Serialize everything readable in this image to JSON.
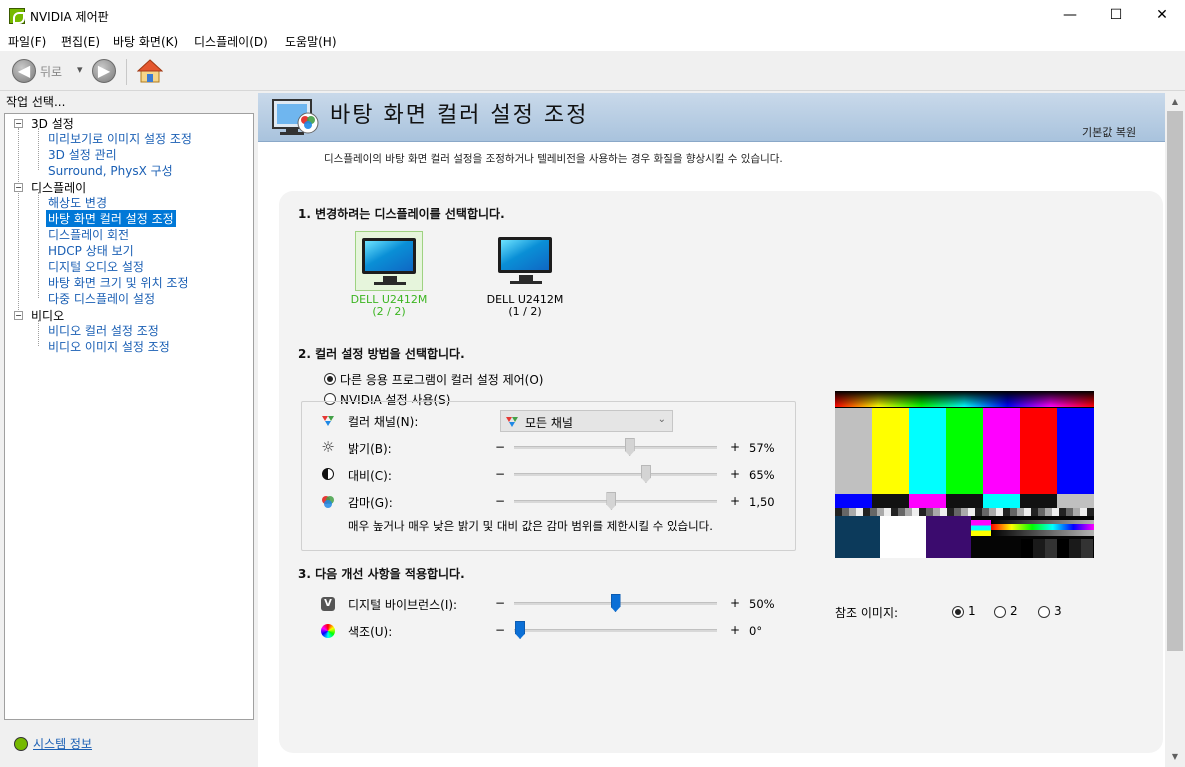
{
  "window": {
    "title": "NVIDIA 제어판",
    "minimize": "—",
    "maximize": "☐",
    "close": "✕"
  },
  "menu": [
    "파일(F)",
    "편집(E)",
    "바탕 화면(K)",
    "디스플레이(D)",
    "도움말(H)"
  ],
  "toolbar": {
    "back_label": "뒤로",
    "back_arrow": "◀",
    "forward_arrow": "▶",
    "dropdown": "▾"
  },
  "left": {
    "header": "작업 선택...",
    "tree": [
      {
        "label": "3D 설정",
        "children": [
          "미리보기로 이미지 설정 조정",
          "3D 설정 관리",
          "Surround, PhysX 구성"
        ]
      },
      {
        "label": "디스플레이",
        "children": [
          "해상도 변경",
          "바탕 화면 컬러 설정 조정",
          "디스플레이 회전",
          "HDCP 상태 보기",
          "디지털 오디오 설정",
          "바탕 화면 크기 및 위치 조정",
          "다중 디스플레이 설정"
        ]
      },
      {
        "label": "비디오",
        "children": [
          "비디오 컬러 설정 조정",
          "비디오 이미지 설정 조정"
        ]
      }
    ],
    "selected": "바탕 화면 컬러 설정 조정",
    "collapse_glyph": "−",
    "system_info": "시스템 정보"
  },
  "page": {
    "title": "바탕 화면 컬러 설정 조정",
    "restore": "기본값 복원",
    "description": "디스플레이의 바탕 화면 컬러 설정을 조정하거나 텔레비전을 사용하는 경우 화질을 향상시킬 수 있습니다."
  },
  "section1": {
    "title": "1. 변경하려는 디스플레이를 선택합니다.",
    "monitors": [
      {
        "name": "DELL U2412M",
        "index": "(2 / 2)",
        "selected": true
      },
      {
        "name": "DELL U2412M",
        "index": "(1 / 2)",
        "selected": false
      }
    ]
  },
  "section2": {
    "title": "2. 컬러 설정 방법을 선택합니다.",
    "option_other": "다른 응용 프로그램이 컬러 설정 제어(O)",
    "option_nvidia": "NVIDIA 설정 사용(S)",
    "selected_option": "other",
    "channel_label": "컬러 채널(N):",
    "channel_value": "모든 채널",
    "dropdown_arrow": "⌄",
    "brightness": {
      "label": "밝기(B):",
      "minus": "−",
      "plus": "+",
      "value": "57%",
      "level": 0.57
    },
    "contrast": {
      "label": "대비(C):",
      "minus": "−",
      "plus": "+",
      "value": "65%",
      "level": 0.65
    },
    "gamma": {
      "label": "감마(G):",
      "minus": "−",
      "plus": "+",
      "value": "1,50",
      "level": 0.48
    },
    "note": "매우 높거나 매우 낮은 밝기 및 대비 값은 감마 범위를 제한시킬 수 있습니다."
  },
  "section3": {
    "title": "3. 다음 개선 사항을 적용합니다.",
    "vibrance": {
      "label": "디지털 바이브런스(I):",
      "minus": "−",
      "plus": "+",
      "value": "50%",
      "level": 0.5
    },
    "hue": {
      "label": "색조(U):",
      "minus": "−",
      "plus": "+",
      "value": "0°",
      "level": 0.0
    },
    "vibrance_icon_glyph": "V"
  },
  "reference": {
    "label": "참조 이미지:",
    "options": [
      "1",
      "2",
      "3"
    ],
    "selected": "1"
  },
  "scroll": {
    "up": "▲",
    "down": "▼"
  },
  "colors": {
    "accent": "#0078d7",
    "link": "#1a5fb4",
    "nvidia_green": "#76b900",
    "selected_monitor_text": "#3cb521",
    "slider_blue": "#0b6fd6"
  },
  "test_pattern_bars": [
    "#c0c0c0",
    "#ffff00",
    "#00ffff",
    "#00ff00",
    "#ff00ff",
    "#ff0000",
    "#0000ff"
  ]
}
